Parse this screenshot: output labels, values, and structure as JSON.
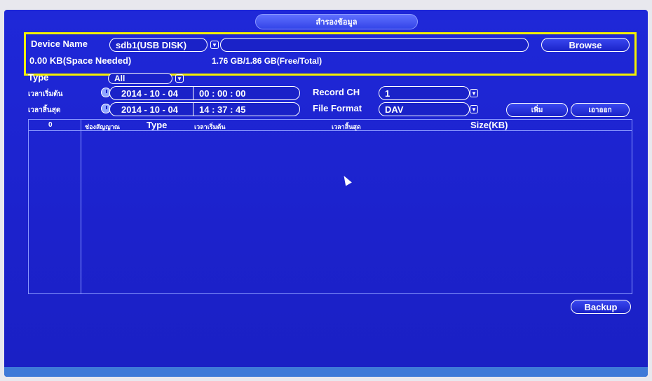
{
  "window": {
    "title": "สำรองข้อมูล"
  },
  "device": {
    "label": "Device Name",
    "selected": "sdb1(USB DISK)",
    "path_value": "",
    "browse_label": "Browse",
    "space_needed": "0.00 KB(Space Needed)",
    "free_total": "1.76 GB/1.86 GB(Free/Total)"
  },
  "filter": {
    "type_label": "Type",
    "type_value": "All",
    "start_label": "เวลาเริ่มต้น",
    "start_date": "2014 - 10 - 04",
    "start_time": "00 : 00 : 00",
    "end_label": "เวลาสิ้นสุด",
    "end_date": "2014 - 10 - 04",
    "end_time": "14 : 37 : 45",
    "record_ch_label": "Record CH",
    "record_ch_value": "1",
    "file_format_label": "File Format",
    "file_format_value": "DAV",
    "add_label": "เพิ่ม",
    "remove_label": "เอาออก"
  },
  "table": {
    "count": "0",
    "columns": [
      "ช่องสัญญาณ",
      "Type",
      "เวลาเริ่มต้น",
      "เวลาสิ้นสุด",
      "Size(KB)"
    ],
    "rows": []
  },
  "actions": {
    "backup_label": "Backup"
  },
  "colors": {
    "background": "#1c22cc",
    "highlight": "#f4f000",
    "border": "#ffffff"
  },
  "icons": {
    "clock": "clock-icon",
    "dropdown": "dropdown-arrow-icon",
    "cursor": "mouse-pointer-icon"
  }
}
